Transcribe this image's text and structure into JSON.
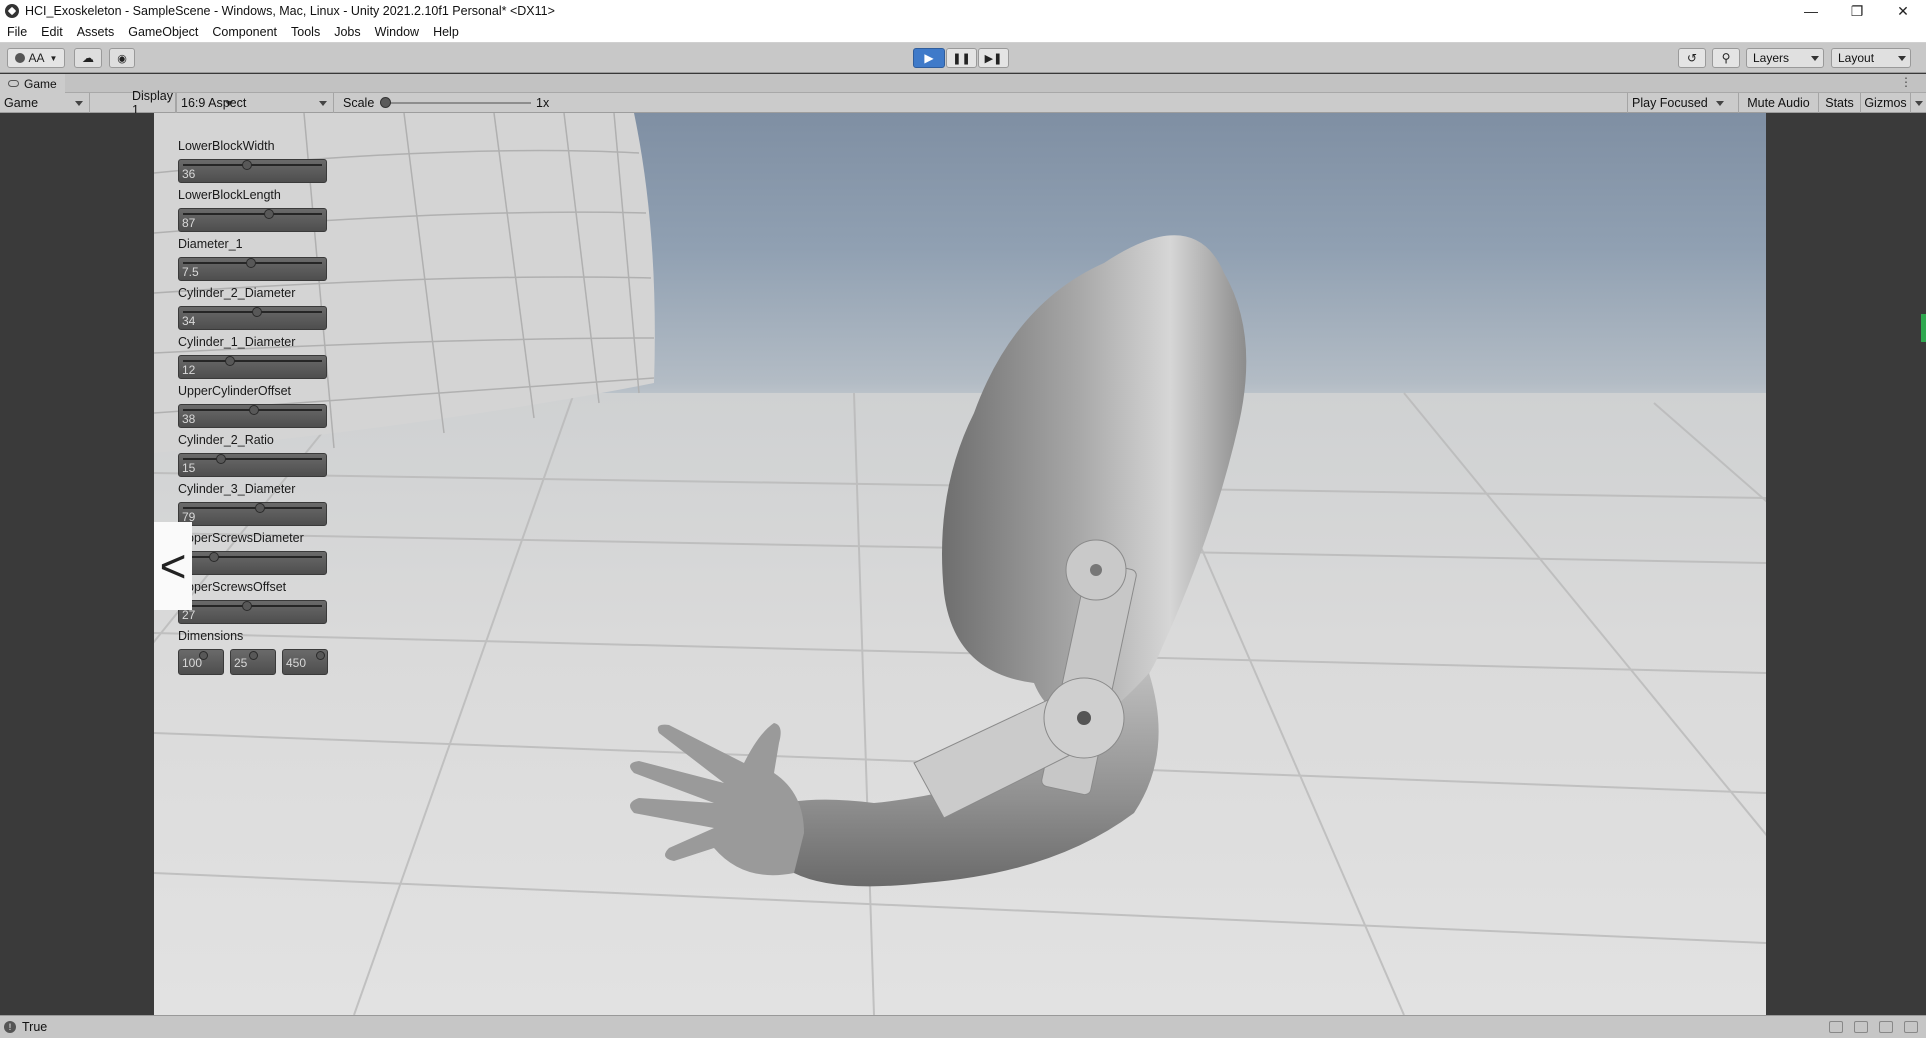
{
  "window": {
    "title": "HCI_Exoskeleton - SampleScene - Windows, Mac, Linux - Unity 2021.2.10f1 Personal* <DX11>",
    "controls": [
      "minimize-icon",
      "restore-icon",
      "close-icon"
    ]
  },
  "menu": [
    "File",
    "Edit",
    "Assets",
    "GameObject",
    "Component",
    "Tools",
    "Jobs",
    "Window",
    "Help"
  ],
  "toolbar": {
    "account_label": "AA",
    "layers_label": "Layers",
    "layout_label": "Layout",
    "play_state": "playing"
  },
  "game_tab": {
    "label": "Game"
  },
  "game_bar": {
    "view_mode": "Game",
    "display": "Display 1",
    "aspect": "16:9 Aspect",
    "scale_label": "Scale",
    "scale_value": "1x",
    "play_focused": "Play Focused",
    "mute_audio": "Mute Audio",
    "stats": "Stats",
    "gizmos": "Gizmos"
  },
  "parameters": [
    {
      "label": "LowerBlockWidth",
      "value": "36",
      "fill": 0.45
    },
    {
      "label": "LowerBlockLength",
      "value": "87",
      "fill": 0.62
    },
    {
      "label": "Diameter_1",
      "value": "7.5",
      "fill": 0.48
    },
    {
      "label": "Cylinder_2_Diameter",
      "value": "34",
      "fill": 0.53
    },
    {
      "label": "Cylinder_1_Diameter",
      "value": "12",
      "fill": 0.32
    },
    {
      "label": "UpperCylinderOffset",
      "value": "38",
      "fill": 0.5
    },
    {
      "label": "Cylinder_2_Ratio",
      "value": "15",
      "fill": 0.25
    },
    {
      "label": "Cylinder_3_Diameter",
      "value": "79",
      "fill": 0.55
    },
    {
      "label": "UpperScrewsDiameter",
      "value": "2",
      "fill": 0.2
    },
    {
      "label": "UpperScrewsOffset",
      "value": "27",
      "fill": 0.45
    }
  ],
  "dimensions": {
    "label": "Dimensions",
    "values": [
      "100",
      "25",
      "450"
    ]
  },
  "back_tab_glyph": "<",
  "status": {
    "text": "True"
  }
}
